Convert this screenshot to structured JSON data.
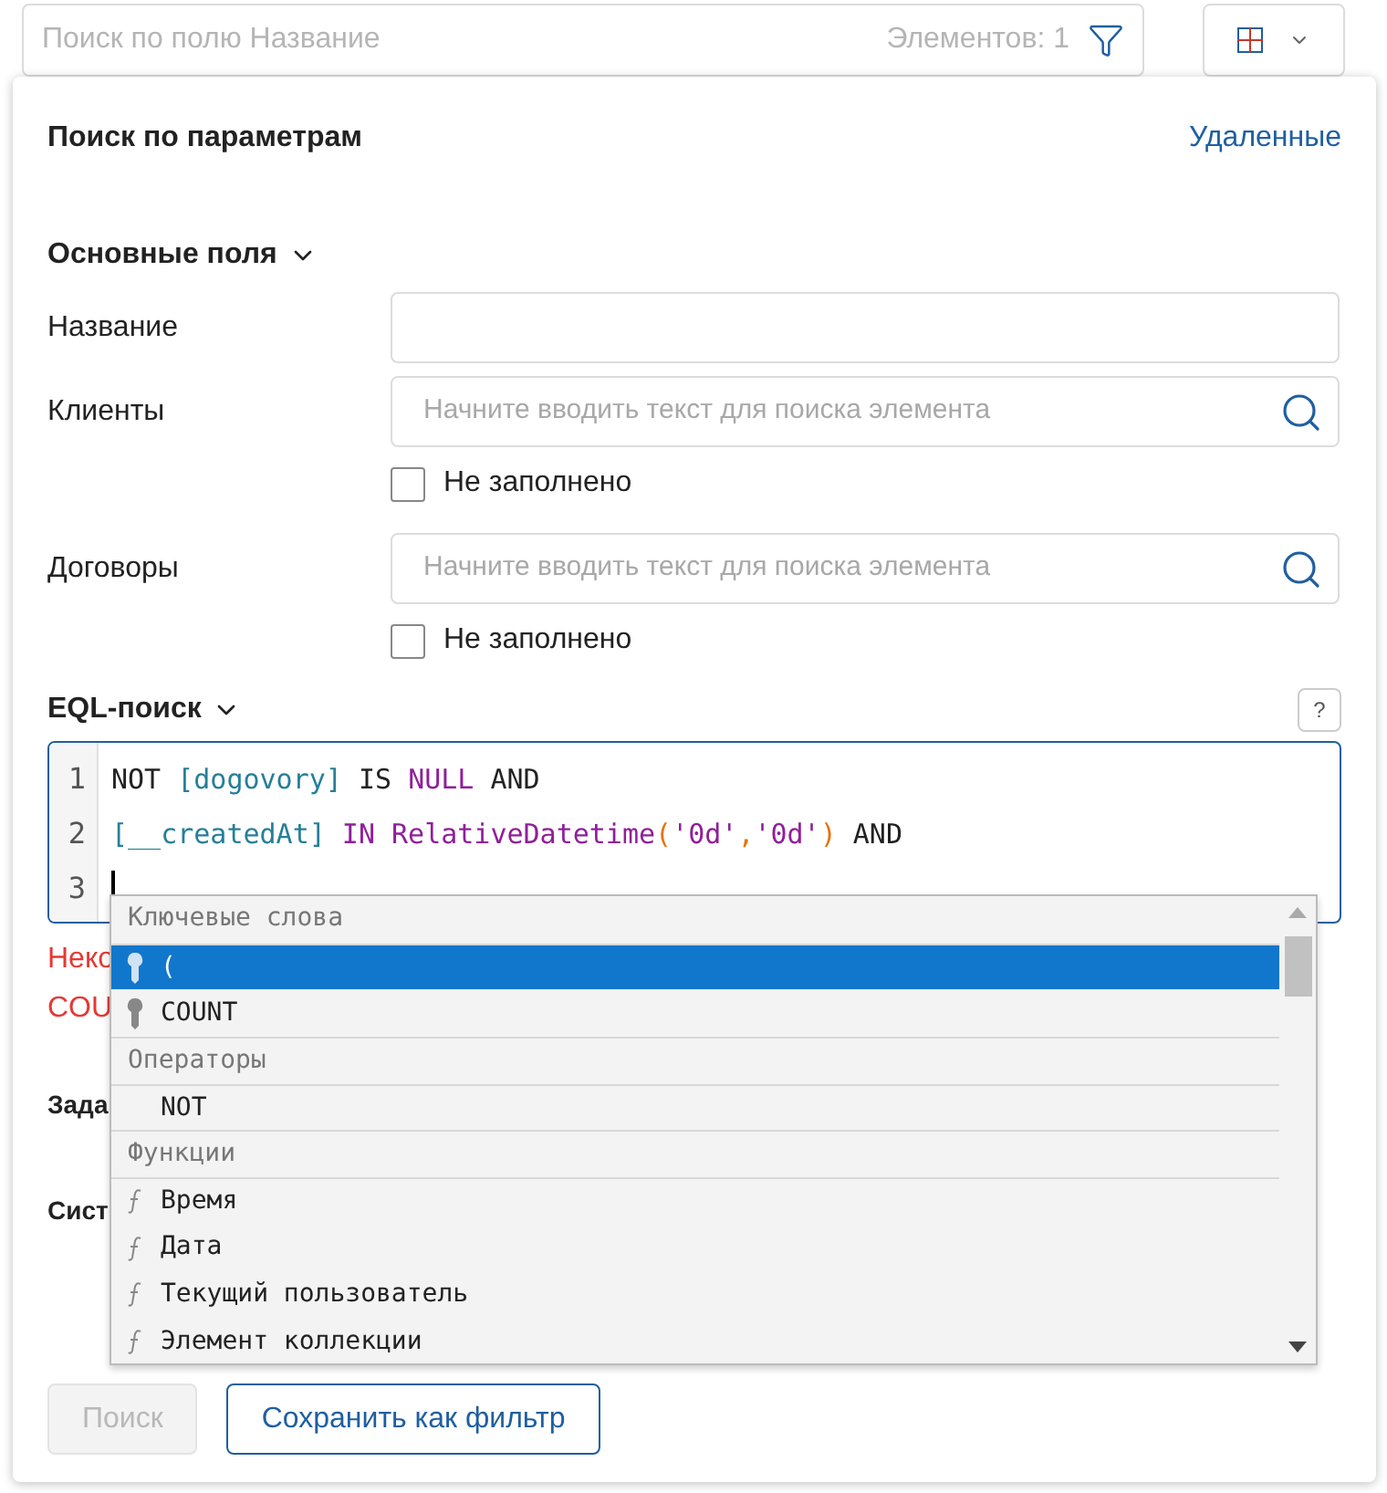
{
  "search": {
    "placeholder": "Поиск по полю Название",
    "count": "Элементов: 1"
  },
  "panel": {
    "title": "Поиск по параметрам",
    "deleted_link": "Удаленные",
    "main_section": {
      "title": "Основные поля",
      "expanded": true
    },
    "fields": [
      {
        "label": "Название",
        "kind": "text"
      },
      {
        "label": "Клиенты",
        "kind": "lookup",
        "placeholder": "Начните вводить текст для поиска элемента",
        "empty_label": "Не заполнено",
        "empty_checked": false
      },
      {
        "label": "Договоры",
        "kind": "lookup",
        "placeholder": "Начните вводить текст для поиска элемента",
        "empty_label": "Не заполнено",
        "empty_checked": false
      }
    ],
    "eql": {
      "title": "EQL-поиск",
      "expanded": true,
      "help": "?",
      "lines": [
        {
          "number": "1",
          "tokens": [
            {
              "text": "NOT ",
              "kind": "plain"
            },
            {
              "text": "[dogovory]",
              "kind": "field"
            },
            {
              "text": " IS ",
              "kind": "plain"
            },
            {
              "text": "NULL",
              "kind": "keyword"
            },
            {
              "text": " AND",
              "kind": "plain"
            }
          ]
        },
        {
          "number": "2",
          "tokens": [
            {
              "text": "[__createdAt]",
              "kind": "field"
            },
            {
              "text": " IN RelativeDatetime",
              "kind": "keyword"
            },
            {
              "text": "(",
              "kind": "paren"
            },
            {
              "text": "'0d'",
              "kind": "string"
            },
            {
              "text": ",",
              "kind": "paren"
            },
            {
              "text": "'0d'",
              "kind": "string"
            },
            {
              "text": ")",
              "kind": "paren"
            },
            {
              "text": " AND",
              "kind": "plain"
            }
          ]
        },
        {
          "number": "3"
        }
      ],
      "error_lines": [
        "Неко",
        "COU"
      ],
      "suggestions": [
        {
          "kind": "header",
          "text": "Ключевые слова",
          "selected": false
        },
        {
          "kind": "keyword",
          "text": "(",
          "selected": true
        },
        {
          "kind": "keyword",
          "text": "COUNT",
          "selected": false
        },
        {
          "kind": "header",
          "text": "Операторы",
          "selected": false
        },
        {
          "kind": "operator",
          "text": "NOT",
          "selected": false
        },
        {
          "kind": "header",
          "text": "Функции",
          "selected": false
        },
        {
          "kind": "function",
          "text": "Время",
          "selected": false
        },
        {
          "kind": "function",
          "text": "Дата",
          "selected": false
        },
        {
          "kind": "function",
          "text": "Текущий пользователь",
          "selected": false
        },
        {
          "kind": "function",
          "text": "Элемент коллекции",
          "selected": false
        }
      ]
    },
    "other_sections": [
      "Зада",
      "Сист"
    ],
    "buttons": [
      {
        "label": "Поиск",
        "disabled": true
      },
      {
        "label": "Сохранить как фильтр",
        "disabled": false
      }
    ]
  }
}
